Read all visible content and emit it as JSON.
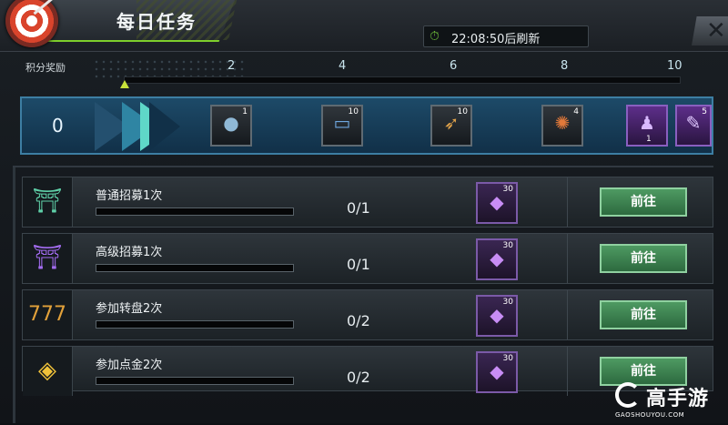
{
  "header": {
    "title": "每日任务",
    "timer_text": "22:08:50后刷新",
    "timer_icon": "stopwatch-icon",
    "close_icon": "close-icon"
  },
  "points": {
    "label": "积分奖励",
    "current": "0",
    "milestones": [
      "2",
      "4",
      "6",
      "8",
      "10"
    ]
  },
  "rewards": [
    {
      "icon": "coin-chip-icon",
      "count": "1"
    },
    {
      "icon": "ticket-icon",
      "count": "10"
    },
    {
      "icon": "bullet-icon",
      "count": "10"
    },
    {
      "icon": "orange-chip-icon",
      "count": "4"
    },
    {
      "icon": "character-card-icon",
      "count": "1"
    },
    {
      "icon": "weapon-card-icon",
      "count": "5"
    }
  ],
  "tasks": [
    {
      "name": "普通招募1次",
      "progress": "0/1",
      "reward_count": "30",
      "button": "前往",
      "icon": "green-recruit-booth-icon"
    },
    {
      "name": "高级招募1次",
      "progress": "0/1",
      "reward_count": "30",
      "button": "前往",
      "icon": "purple-recruit-booth-icon"
    },
    {
      "name": "参加转盘2次",
      "progress": "0/2",
      "reward_count": "30",
      "button": "前往",
      "icon": "slot-777-icon"
    },
    {
      "name": "参加点金2次",
      "progress": "0/2",
      "reward_count": "30",
      "button": "前往",
      "icon": "gold-diamond-icon"
    }
  ],
  "watermark": {
    "name": "高手游",
    "url": "GAOSHOUYOU.COM"
  }
}
